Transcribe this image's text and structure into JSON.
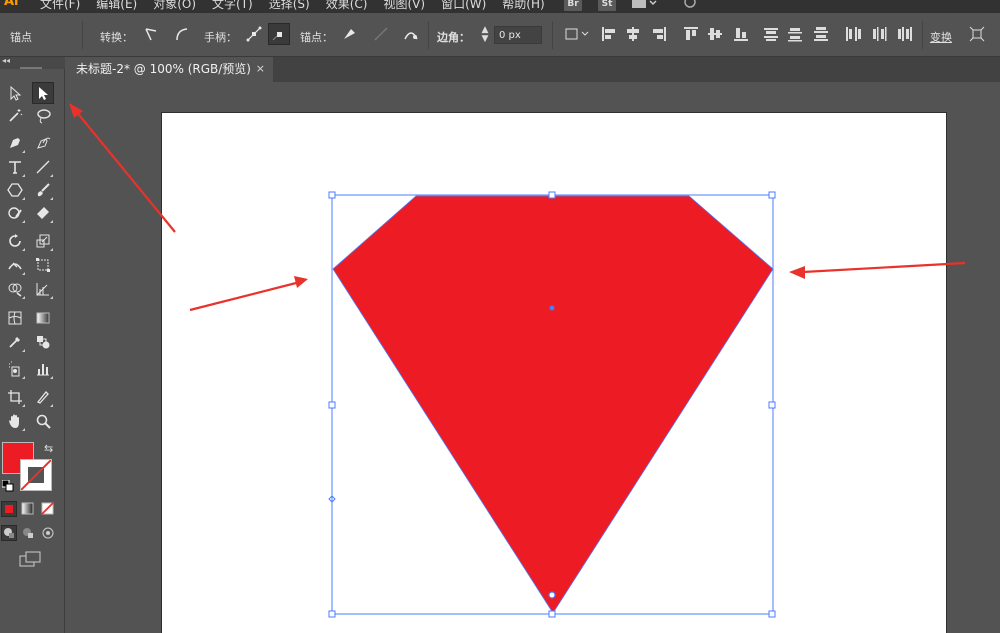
{
  "menubar": {
    "app_logo": "Ai",
    "items": [
      "文件(F)",
      "编辑(E)",
      "对象(O)",
      "文字(T)",
      "选择(S)",
      "效果(C)",
      "视图(V)",
      "窗口(W)",
      "帮助(H)"
    ],
    "bridge_label": "Br",
    "stock_label": "St"
  },
  "controlbar": {
    "anchor_label": "锚点",
    "convert_label": "转换：",
    "handle_label": "手柄：",
    "anchor_point_label": "锚点：",
    "corner_label": "边角：",
    "corner_value": "0 px",
    "transform_label": "变换"
  },
  "tab": {
    "title": "未标题-2* @ 100% (RGB/预览)",
    "close_label": "×"
  },
  "colors": {
    "fill": "#ed1c24",
    "selection": "#4a7cff",
    "arrow": "#e8322b"
  },
  "toolbar": {
    "active_tool": "direct-selection-tool"
  }
}
